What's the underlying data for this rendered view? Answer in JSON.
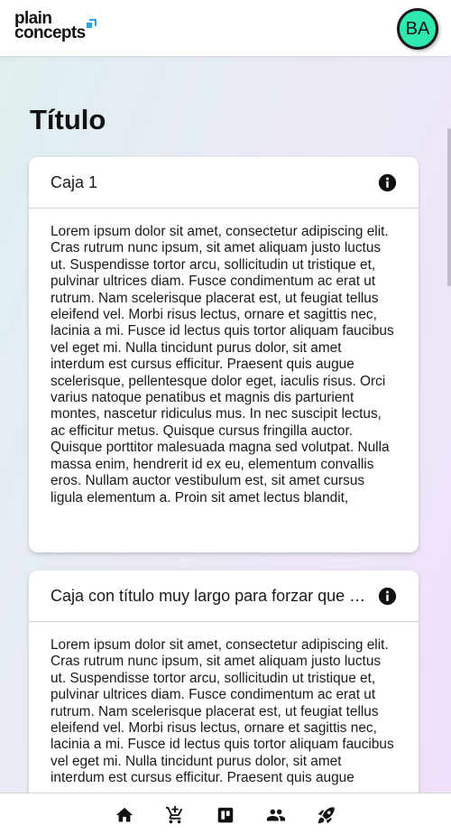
{
  "header": {
    "logo_line1": "plain",
    "logo_line2": "concepts",
    "logo_accent": "#2aa3df",
    "avatar_initials": "BA",
    "avatar_color": "#2ee8b0"
  },
  "page": {
    "title": "Título"
  },
  "cards": [
    {
      "title": "Caja 1",
      "icon": "info-icon",
      "body": "Lorem ipsum dolor sit amet, consectetur adipiscing elit. Cras rutrum nunc ipsum, sit amet aliquam justo luctus ut. Suspendisse tortor arcu, sollicitudin ut tristique et, pulvinar ultrices diam. Fusce condimentum ac erat ut rutrum. Nam scelerisque placerat est, ut feugiat tellus eleifend vel. Morbi risus lectus, ornare et sagittis nec, lacinia a mi. Fusce id lectus quis tortor aliquam faucibus vel eget mi. Nulla tincidunt purus dolor, sit amet interdum est cursus efficitur. Praesent quis augue scelerisque, pellentesque dolor eget, iaculis risus. Orci varius natoque penatibus et magnis dis parturient montes, nascetur ridiculus mus. In nec suscipit lectus, ac efficitur metus. Quisque cursus fringilla auctor. Quisque porttitor malesuada magna sed volutpat. Nulla massa enim, hendrerit id ex eu, elementum convallis eros. Nullam auctor vestibulum est, sit amet cursus ligula elementum a. Proin sit amet lectus blandit,"
    },
    {
      "title": "Caja con título muy largo para forzar que se corte el texto",
      "icon": "info-icon",
      "body": "Lorem ipsum dolor sit amet, consectetur adipiscing elit. Cras rutrum nunc ipsum, sit amet aliquam justo luctus ut. Suspendisse tortor arcu, sollicitudin ut tristique et, pulvinar ultrices diam. Fusce condimentum ac erat ut rutrum. Nam scelerisque placerat est, ut feugiat tellus eleifend vel. Morbi risus lectus, ornare et sagittis nec, lacinia a mi. Fusce id lectus quis tortor aliquam faucibus vel eget mi. Nulla tincidunt purus dolor, sit amet interdum est cursus efficitur. Praesent quis augue"
    }
  ],
  "bottom_nav": [
    {
      "icon": "home-icon"
    },
    {
      "icon": "add-to-cart-icon"
    },
    {
      "icon": "kanban-board-icon"
    },
    {
      "icon": "people-icon"
    },
    {
      "icon": "rocket-icon"
    }
  ]
}
